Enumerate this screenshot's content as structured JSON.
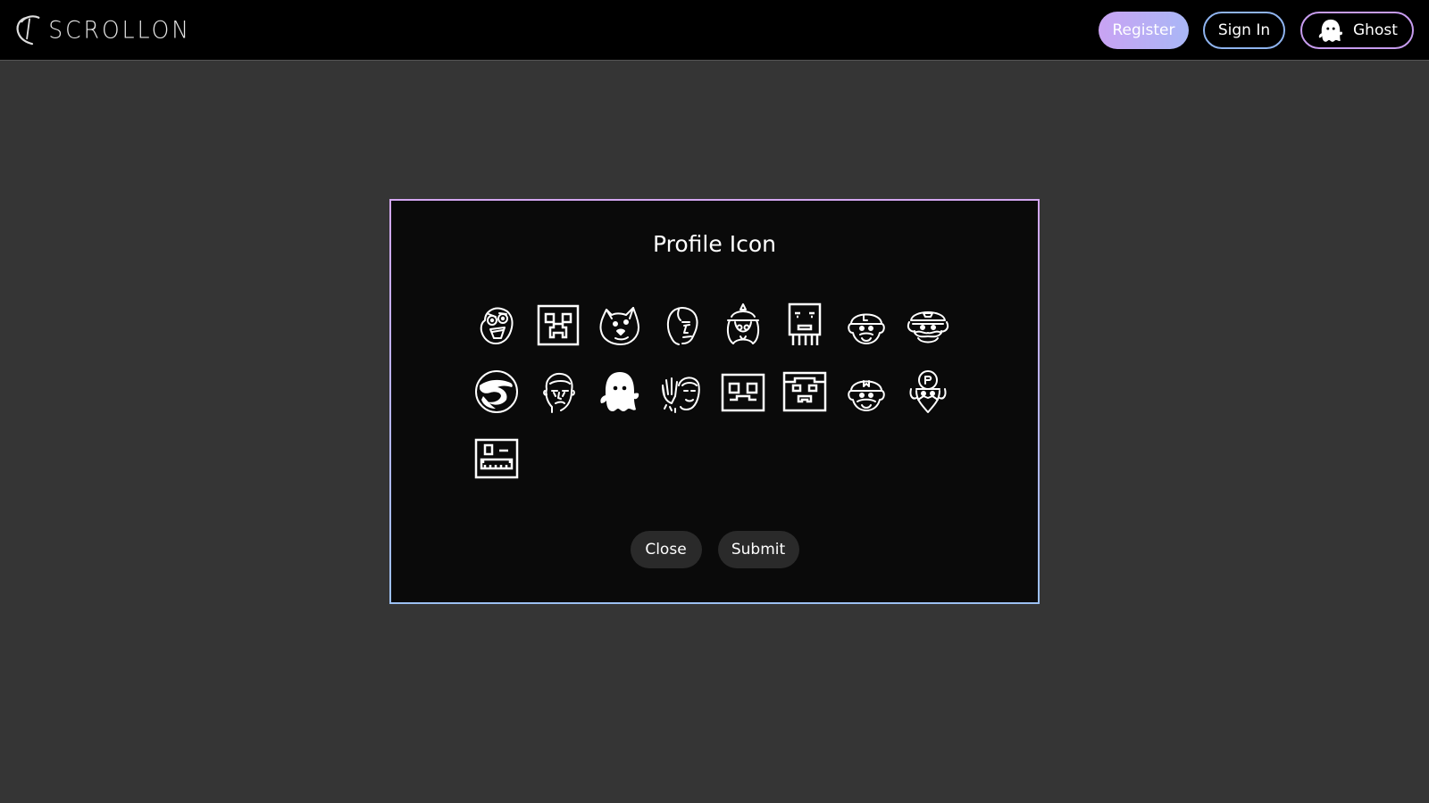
{
  "brand": {
    "name": "SCROLLON"
  },
  "nav": {
    "register_label": "Register",
    "signin_label": "Sign In",
    "user_label": "Ghost",
    "user_icon": "ghost-icon"
  },
  "modal": {
    "title": "Profile Icon",
    "icons": [
      "rage-face-icon",
      "creeper-icon",
      "doge-icon",
      "meme-face-icon",
      "anime-girl-icon",
      "ghast-icon",
      "luigi-icon",
      "wario-icon",
      "dragon-icon",
      "sad-man-icon",
      "ghost-icon",
      "waving-man-icon",
      "block-face-icon",
      "block-creature-icon",
      "mario-icon",
      "waluigi-icon",
      "pixel-robot-icon"
    ],
    "selected_icon": "ghost-icon",
    "close_label": "Close",
    "submit_label": "Submit"
  },
  "colors": {
    "background": "#353535",
    "navbar": "#000000",
    "modal": "#0a0a0a",
    "accent_purple": "#c9a3f3",
    "accent_blue": "#a9b7f6"
  }
}
